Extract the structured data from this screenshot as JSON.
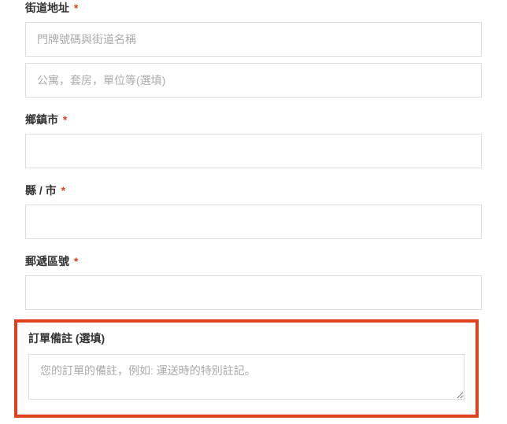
{
  "fields": {
    "street": {
      "label": "街道地址",
      "required_mark": "*",
      "placeholder1": "門牌號碼與街道名稱",
      "placeholder2": "公寓，套房，單位等(選填)"
    },
    "city": {
      "label": "鄉鎮市",
      "required_mark": "*"
    },
    "county": {
      "label": "縣 / 市",
      "required_mark": "*"
    },
    "postcode": {
      "label": "郵遞區號",
      "required_mark": "*"
    },
    "notes": {
      "label": "訂單備註 (選填)",
      "placeholder": "您的訂單的備註，例如: 運送時的特別註記。"
    }
  }
}
